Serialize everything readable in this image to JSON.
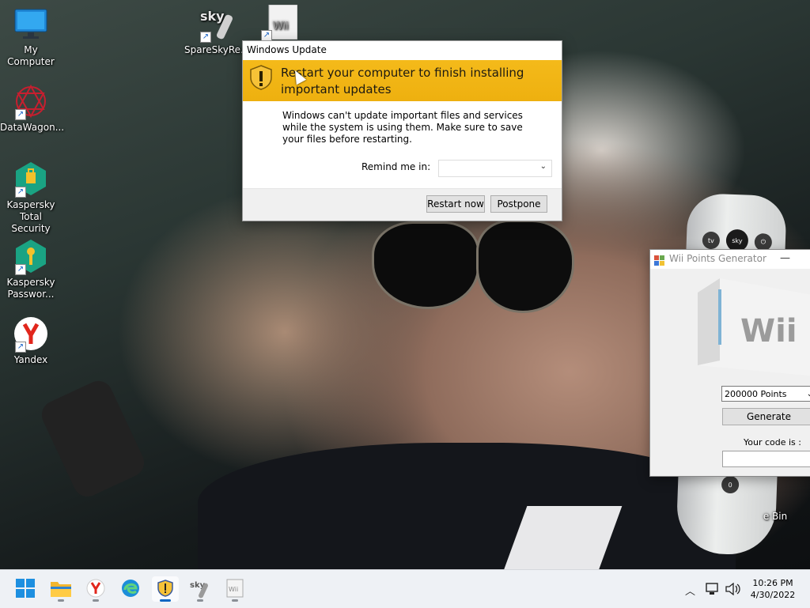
{
  "desktop": {
    "icons": [
      {
        "label": "My Computer",
        "icon": "monitor-icon"
      },
      {
        "label": "DataWagon...",
        "icon": "datawagon-icon"
      },
      {
        "label": "Kaspersky Total Security",
        "icon": "kaspersky-shield-icon"
      },
      {
        "label": "Kaspersky Passwor...",
        "icon": "kaspersky-key-icon"
      },
      {
        "label": "Yandex",
        "icon": "yandex-icon"
      },
      {
        "label": "SpareSkyRe...",
        "icon": "sky-remote-icon"
      },
      {
        "label": "e Bin",
        "icon": "recycle-bin-icon"
      }
    ],
    "remote_labels": {
      "tv": "tv",
      "sky": "sky",
      "power": "⏻"
    }
  },
  "windows_update": {
    "title": "Windows Update",
    "heading": "Restart your computer to finish installing important updates",
    "body": "Windows can't update important files and services while the system is using them. Make sure to save your files before restarting.",
    "remind_label": "Remind me in:",
    "remind_value": "",
    "restart_button": "Restart now",
    "postpone_button": "Postpone",
    "banner_color": "#f2b416"
  },
  "wii_generator": {
    "title": "Wii Points Generator",
    "logo_text": "Wii",
    "points_selected": "200000 Points",
    "generate_button": "Generate",
    "code_label": "Your code is :",
    "code_value": ""
  },
  "taskbar": {
    "items": [
      {
        "name": "start-button",
        "icon": "windows-start-icon"
      },
      {
        "name": "file-explorer",
        "icon": "folder-icon"
      },
      {
        "name": "yandex-browser",
        "icon": "yandex-icon"
      },
      {
        "name": "edge-browser",
        "icon": "edge-icon"
      },
      {
        "name": "windows-update-app",
        "icon": "shield-warning-icon"
      },
      {
        "name": "sky-remote-app",
        "icon": "sky-remote-icon"
      },
      {
        "name": "wii-generator-app",
        "icon": "wii-icon"
      }
    ],
    "time": "10:26 PM",
    "date": "4/30/2022"
  },
  "colors": {
    "taskbar": "#eef1f5",
    "accent": "#0a66c2"
  }
}
